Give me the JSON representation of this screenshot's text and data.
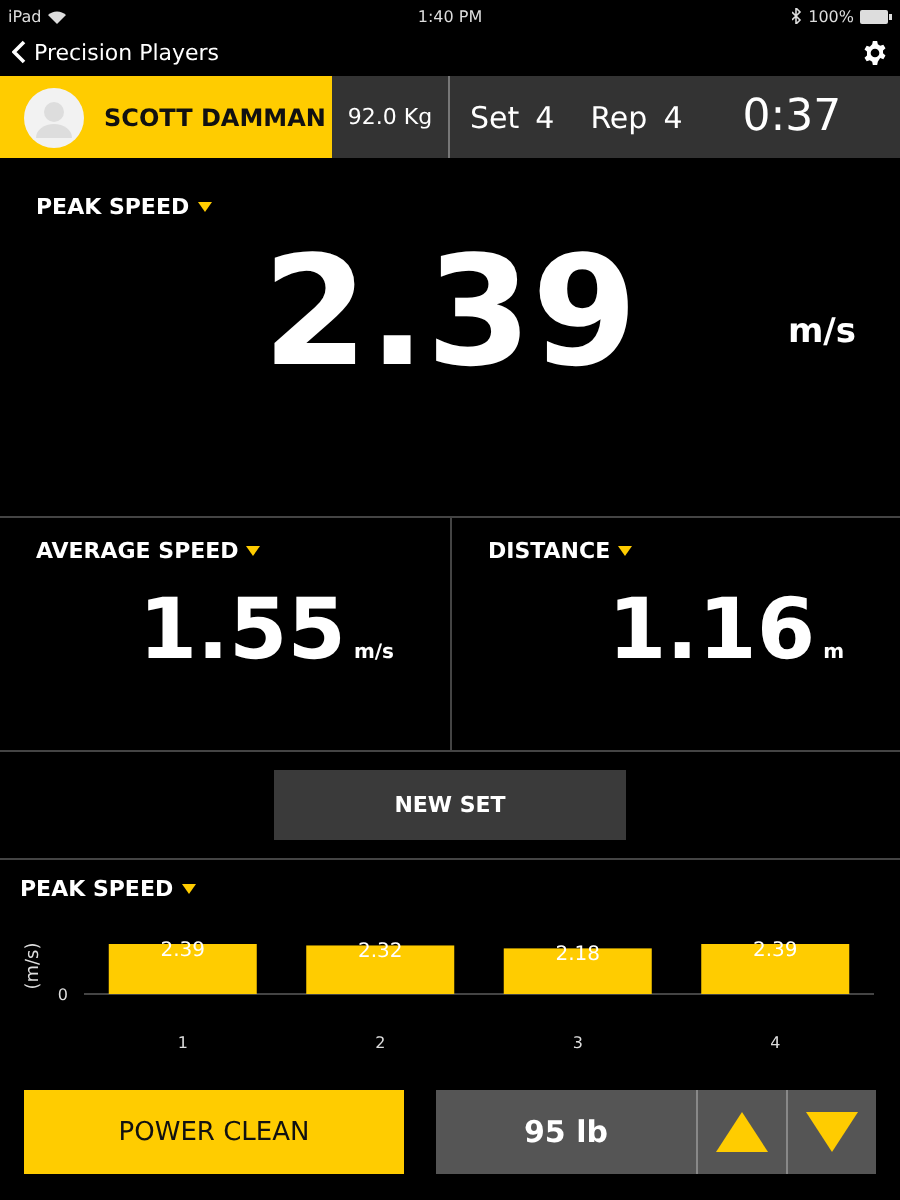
{
  "status_bar": {
    "carrier": "iPad",
    "time": "1:40 PM",
    "battery": "100%"
  },
  "nav": {
    "back_label": "Precision Players"
  },
  "athlete_bar": {
    "name": "SCOTT DAMMAN",
    "weight": "92.0 Kg",
    "set_label": "Set",
    "set": "4",
    "rep_label": "Rep",
    "rep": "4",
    "timer": "0:37"
  },
  "peak": {
    "title": "PEAK SPEED",
    "value": "2.39",
    "unit": "m/s"
  },
  "metrics": [
    {
      "title": "AVERAGE SPEED",
      "value": "1.55",
      "unit": "m/s"
    },
    {
      "title": "DISTANCE",
      "value": "1.16",
      "unit": "m"
    }
  ],
  "new_set_button": "NEW SET",
  "chart": {
    "title": "PEAK SPEED",
    "baseline_label": "0",
    "chart_data": {
      "type": "bar",
      "ylabel": "(m/s)",
      "categories": [
        "1",
        "2",
        "3",
        "4"
      ],
      "series": [
        {
          "color": "#ffcc00",
          "values": [
            2.39,
            2.32,
            2.18,
            2.39
          ]
        }
      ],
      "data_labels": true
    }
  },
  "exercise_button": "POWER CLEAN",
  "load": "95 lb"
}
